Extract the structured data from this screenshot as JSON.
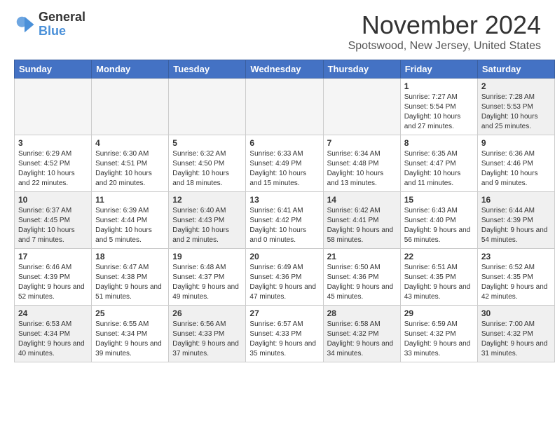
{
  "header": {
    "logo": {
      "general": "General",
      "blue": "Blue"
    },
    "title": "November 2024",
    "location": "Spotswood, New Jersey, United States"
  },
  "weekdays": [
    "Sunday",
    "Monday",
    "Tuesday",
    "Wednesday",
    "Thursday",
    "Friday",
    "Saturday"
  ],
  "weeks": [
    [
      {
        "day": "",
        "info": "",
        "empty": true
      },
      {
        "day": "",
        "info": "",
        "empty": true
      },
      {
        "day": "",
        "info": "",
        "empty": true
      },
      {
        "day": "",
        "info": "",
        "empty": true
      },
      {
        "day": "",
        "info": "",
        "empty": true
      },
      {
        "day": "1",
        "info": "Sunrise: 7:27 AM\nSunset: 5:54 PM\nDaylight: 10 hours and 27 minutes."
      },
      {
        "day": "2",
        "info": "Sunrise: 7:28 AM\nSunset: 5:53 PM\nDaylight: 10 hours and 25 minutes."
      }
    ],
    [
      {
        "day": "3",
        "info": "Sunrise: 6:29 AM\nSunset: 4:52 PM\nDaylight: 10 hours and 22 minutes."
      },
      {
        "day": "4",
        "info": "Sunrise: 6:30 AM\nSunset: 4:51 PM\nDaylight: 10 hours and 20 minutes."
      },
      {
        "day": "5",
        "info": "Sunrise: 6:32 AM\nSunset: 4:50 PM\nDaylight: 10 hours and 18 minutes."
      },
      {
        "day": "6",
        "info": "Sunrise: 6:33 AM\nSunset: 4:49 PM\nDaylight: 10 hours and 15 minutes."
      },
      {
        "day": "7",
        "info": "Sunrise: 6:34 AM\nSunset: 4:48 PM\nDaylight: 10 hours and 13 minutes."
      },
      {
        "day": "8",
        "info": "Sunrise: 6:35 AM\nSunset: 4:47 PM\nDaylight: 10 hours and 11 minutes."
      },
      {
        "day": "9",
        "info": "Sunrise: 6:36 AM\nSunset: 4:46 PM\nDaylight: 10 hours and 9 minutes."
      }
    ],
    [
      {
        "day": "10",
        "info": "Sunrise: 6:37 AM\nSunset: 4:45 PM\nDaylight: 10 hours and 7 minutes."
      },
      {
        "day": "11",
        "info": "Sunrise: 6:39 AM\nSunset: 4:44 PM\nDaylight: 10 hours and 5 minutes."
      },
      {
        "day": "12",
        "info": "Sunrise: 6:40 AM\nSunset: 4:43 PM\nDaylight: 10 hours and 2 minutes."
      },
      {
        "day": "13",
        "info": "Sunrise: 6:41 AM\nSunset: 4:42 PM\nDaylight: 10 hours and 0 minutes."
      },
      {
        "day": "14",
        "info": "Sunrise: 6:42 AM\nSunset: 4:41 PM\nDaylight: 9 hours and 58 minutes."
      },
      {
        "day": "15",
        "info": "Sunrise: 6:43 AM\nSunset: 4:40 PM\nDaylight: 9 hours and 56 minutes."
      },
      {
        "day": "16",
        "info": "Sunrise: 6:44 AM\nSunset: 4:39 PM\nDaylight: 9 hours and 54 minutes."
      }
    ],
    [
      {
        "day": "17",
        "info": "Sunrise: 6:46 AM\nSunset: 4:39 PM\nDaylight: 9 hours and 52 minutes."
      },
      {
        "day": "18",
        "info": "Sunrise: 6:47 AM\nSunset: 4:38 PM\nDaylight: 9 hours and 51 minutes."
      },
      {
        "day": "19",
        "info": "Sunrise: 6:48 AM\nSunset: 4:37 PM\nDaylight: 9 hours and 49 minutes."
      },
      {
        "day": "20",
        "info": "Sunrise: 6:49 AM\nSunset: 4:36 PM\nDaylight: 9 hours and 47 minutes."
      },
      {
        "day": "21",
        "info": "Sunrise: 6:50 AM\nSunset: 4:36 PM\nDaylight: 9 hours and 45 minutes."
      },
      {
        "day": "22",
        "info": "Sunrise: 6:51 AM\nSunset: 4:35 PM\nDaylight: 9 hours and 43 minutes."
      },
      {
        "day": "23",
        "info": "Sunrise: 6:52 AM\nSunset: 4:35 PM\nDaylight: 9 hours and 42 minutes."
      }
    ],
    [
      {
        "day": "24",
        "info": "Sunrise: 6:53 AM\nSunset: 4:34 PM\nDaylight: 9 hours and 40 minutes."
      },
      {
        "day": "25",
        "info": "Sunrise: 6:55 AM\nSunset: 4:34 PM\nDaylight: 9 hours and 39 minutes."
      },
      {
        "day": "26",
        "info": "Sunrise: 6:56 AM\nSunset: 4:33 PM\nDaylight: 9 hours and 37 minutes."
      },
      {
        "day": "27",
        "info": "Sunrise: 6:57 AM\nSunset: 4:33 PM\nDaylight: 9 hours and 35 minutes."
      },
      {
        "day": "28",
        "info": "Sunrise: 6:58 AM\nSunset: 4:32 PM\nDaylight: 9 hours and 34 minutes."
      },
      {
        "day": "29",
        "info": "Sunrise: 6:59 AM\nSunset: 4:32 PM\nDaylight: 9 hours and 33 minutes."
      },
      {
        "day": "30",
        "info": "Sunrise: 7:00 AM\nSunset: 4:32 PM\nDaylight: 9 hours and 31 minutes."
      }
    ]
  ]
}
